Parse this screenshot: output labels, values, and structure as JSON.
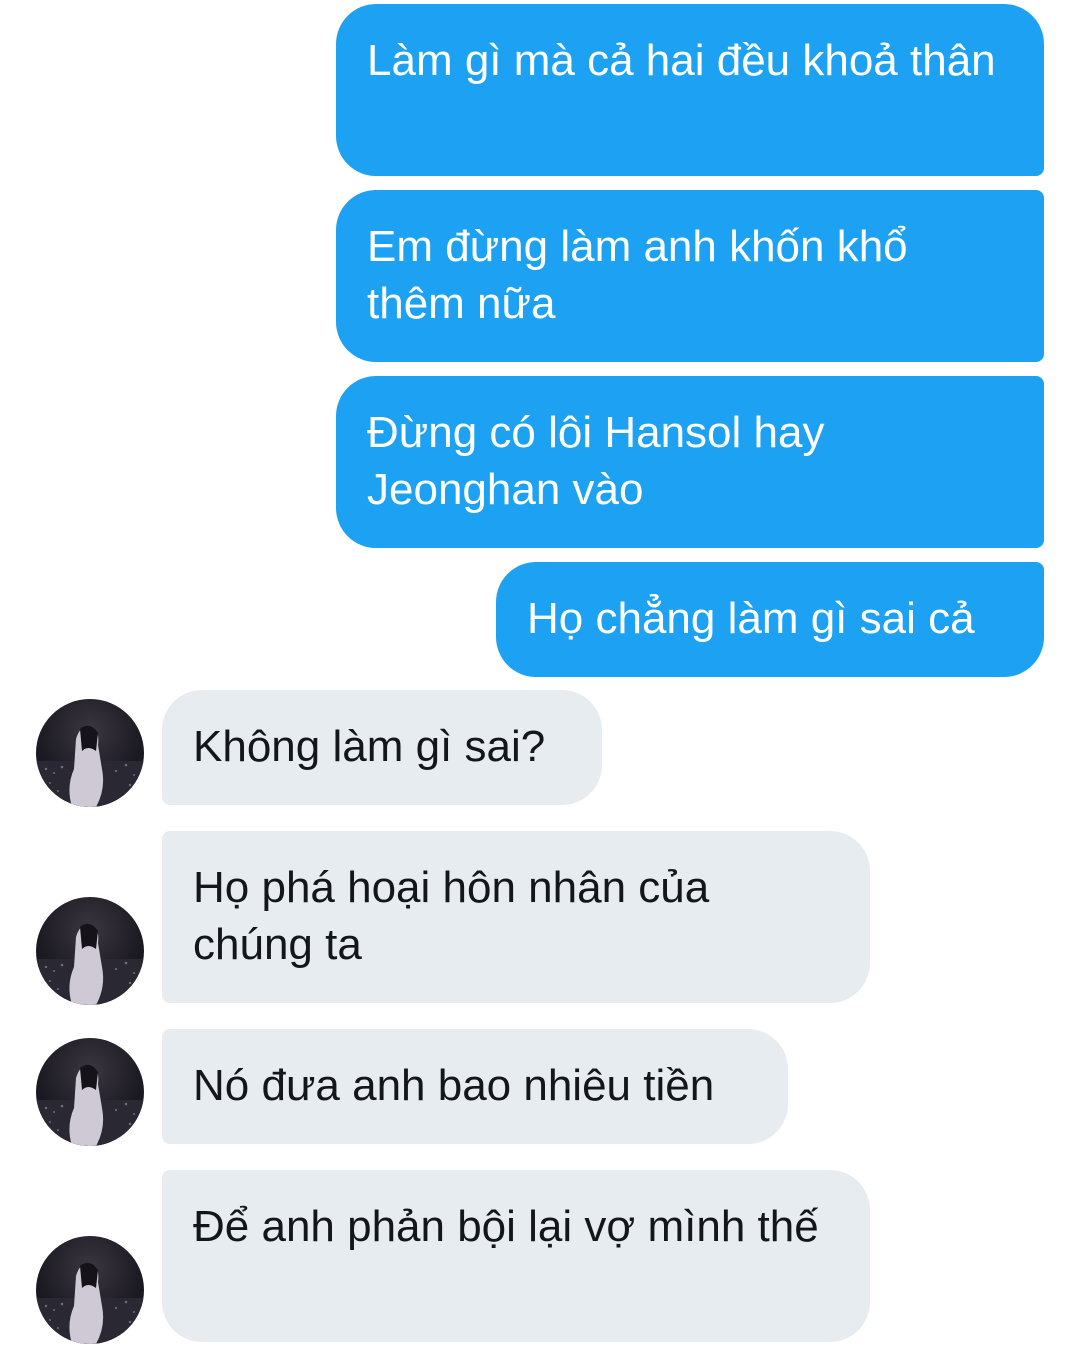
{
  "conversation": {
    "outgoing": [
      {
        "text": "Làm gì mà cả hai đều khoả thân"
      },
      {
        "text": "Em đừng làm anh khốn khổ thêm nữa"
      },
      {
        "text": "Đừng có lôi Hansol hay Jeonghan vào"
      },
      {
        "text": "Họ chẳng làm gì sai cả"
      }
    ],
    "incoming": [
      {
        "text": "Không làm gì sai?"
      },
      {
        "text": "Họ phá hoại hôn nhân của chúng ta"
      },
      {
        "text": "Nó đưa anh bao nhiêu tiền"
      },
      {
        "text": "Để anh phản bội lại vợ mình thế"
      }
    ],
    "avatar_icon": "profile-photo-icon"
  },
  "colors": {
    "outgoing_bubble": "#1da1f2",
    "outgoing_text": "#ffffff",
    "incoming_bubble": "#e6ecf0",
    "incoming_text": "#14171a",
    "background": "#ffffff"
  }
}
